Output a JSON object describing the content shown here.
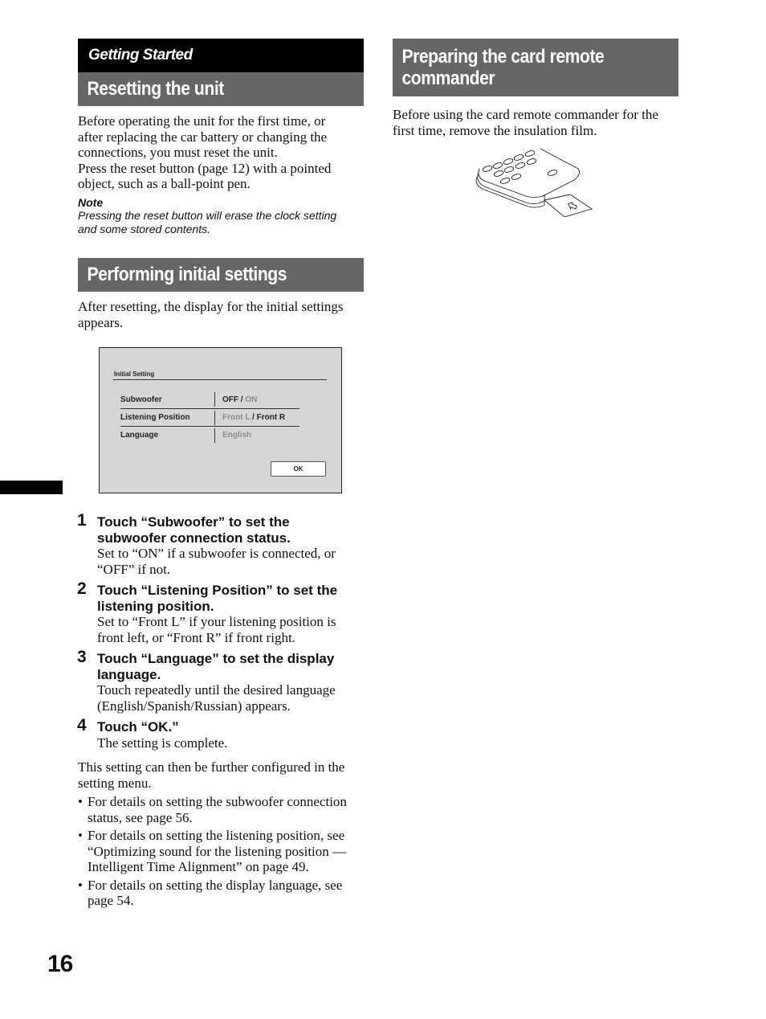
{
  "section_label": "Getting Started",
  "left": {
    "reset": {
      "heading": "Resetting the unit",
      "body_lines": [
        "Before operating the unit for the first time, or",
        "after replacing the car battery or changing the",
        "connections, you must reset the unit.",
        "Press the reset button (page 12) with a pointed",
        "object, such as a ball-point pen."
      ],
      "note_title": "Note",
      "note_lines": [
        "Pressing the reset button will erase the clock setting",
        "and some stored contents."
      ]
    },
    "initial": {
      "heading": "Performing initial settings",
      "intro_lines": [
        "After resetting, the display for the initial settings",
        "appears."
      ],
      "screen": {
        "title": "Initial Setting",
        "rows": [
          {
            "label": "Subwoofer",
            "value_a": "OFF",
            "sep": " / ",
            "value_b": "ON"
          },
          {
            "label": "Listening Position",
            "value_a": "Front L",
            "sep": " / ",
            "value_b": "Front R"
          },
          {
            "label": "Language",
            "value_a": "English"
          }
        ],
        "ok_label": "OK"
      },
      "steps": [
        {
          "num": "1",
          "title_lines": [
            "Touch “Subwoofer” to set the",
            "subwoofer connection status."
          ],
          "body_lines": [
            "Set to “ON” if a subwoofer is connected, or",
            "“OFF” if not."
          ]
        },
        {
          "num": "2",
          "title_lines": [
            "Touch “Listening Position” to set the",
            "listening position."
          ],
          "body_lines": [
            "Set to “Front L” if your listening position is",
            "front left, or “Front R” if front right."
          ]
        },
        {
          "num": "3",
          "title_lines": [
            "Touch “Language” to set the display",
            "language."
          ],
          "body_lines": [
            "Touch repeatedly until the desired language",
            "(English/Spanish/Russian) appears."
          ]
        },
        {
          "num": "4",
          "title_lines": [
            "Touch “OK.”"
          ],
          "body_lines": [
            "The setting is complete."
          ]
        }
      ],
      "after_lines": [
        "This setting can then be further configured in the",
        "setting menu."
      ],
      "bullets": [
        [
          "For details on setting the subwoofer connection",
          "status, see page 56."
        ],
        [
          "For details on setting the listening position, see",
          "“Optimizing sound for the listening position —",
          "Intelligent Time Alignment” on page 49."
        ],
        [
          "For details on setting the display language, see",
          "page 54."
        ]
      ]
    }
  },
  "right": {
    "heading_lines": [
      "Preparing the card remote",
      "commander"
    ],
    "body_lines": [
      "Before using the card remote commander for the",
      "first time, remove the insulation film."
    ],
    "illustration": "card-remote-insulation-film-illustration"
  },
  "page_number": "16"
}
